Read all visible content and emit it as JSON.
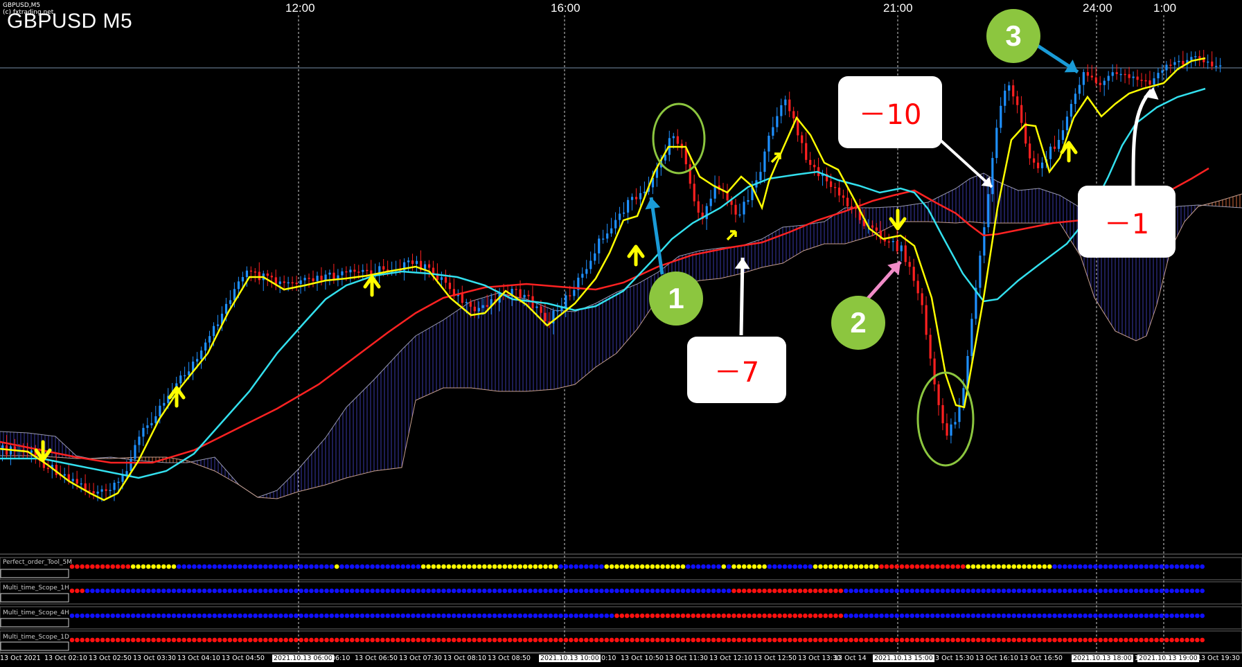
{
  "window": {
    "symbol_title": "GBPUSD M5",
    "small_header_line1": "GBPUSD,M5",
    "small_header_line2": "(c) fxtrading.net"
  },
  "time_axis_top": [
    "12:00",
    "16:00",
    "21:00",
    "24:00",
    "1:00"
  ],
  "annotations": {
    "callouts": [
      "－10",
      "－7",
      "－1"
    ],
    "badges": [
      "1",
      "2",
      "3"
    ]
  },
  "indicator_panels": [
    {
      "name": "Perfect_order_Tool_5M"
    },
    {
      "name": "Multi_time_Scope_1H"
    },
    {
      "name": "Multi_time_Scope_4H"
    },
    {
      "name": "Multi_time_Scope_1D"
    }
  ],
  "bottom_axis": [
    "13 Oct 2021",
    "13 Oct 02:10",
    "13 Oct 02:50",
    "13 Oct 03:30",
    "13 Oct 04:10",
    "13 Oct 04:50",
    "2021.10.13 06:00",
    "06:10",
    "13 Oct 06:50",
    "13 Oct 07:30",
    "13 Oct 08:10",
    "13 Oct 08:50",
    "2021.10.13 10:00",
    "10:10",
    "13 Oct 10:50",
    "13 Oct 11:30",
    "13 Oct 12:10",
    "13 Oct 12:50",
    "13 Oct 13:30",
    "13 Oct 14",
    "2021.10.13 15:00",
    "13 Oct 15:30",
    "13 Oct 16:10",
    "13 Oct 16:50",
    "2021.10.13 18:00",
    "18",
    "2021.10.13 19:00",
    "13 Oct 19:30"
  ],
  "colors": {
    "background": "#000000",
    "bull_candle": "#1e90ff",
    "bear_candle": "#ff2020",
    "ma_fast": "#ffff00",
    "ma_mid": "#33e0ee",
    "ma_slow": "#ff2222",
    "cloud_bull": "#3a3aa8",
    "cloud_bear": "#d26a3c",
    "badge": "#8cc63f",
    "arrow_blue": "#1a9bd7",
    "arrow_pink": "#f08cc8",
    "callout_text": "#ff0000",
    "dot_red": "#ff1010",
    "dot_blue": "#1010ff",
    "dot_yellow": "#ffff00"
  }
}
